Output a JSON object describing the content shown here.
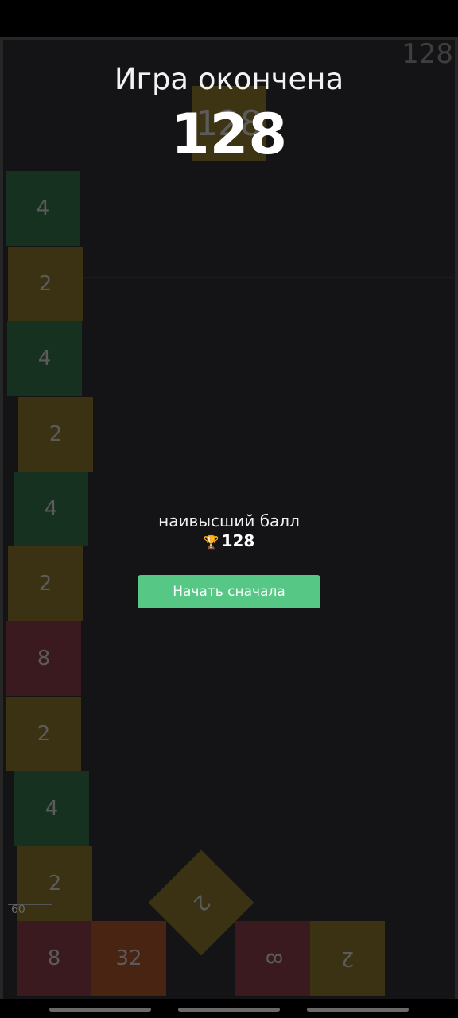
{
  "game": {
    "title": "Игра окончена",
    "score": "128",
    "corner_score": "128",
    "best_label": "наивысший балл",
    "best_score": "128",
    "restart_label": "Начать сначала",
    "fps": "60",
    "icons": {
      "trophy": "trophy-icon"
    },
    "colors": {
      "accent": "#57c785",
      "background": "#141316"
    },
    "tiles": {
      "top_128": "128",
      "left": [
        "4",
        "2",
        "4",
        "2",
        "4",
        "2",
        "8",
        "2",
        "4",
        "2"
      ],
      "bottom": [
        "8",
        "32",
        "2",
        "8",
        "2"
      ]
    }
  }
}
